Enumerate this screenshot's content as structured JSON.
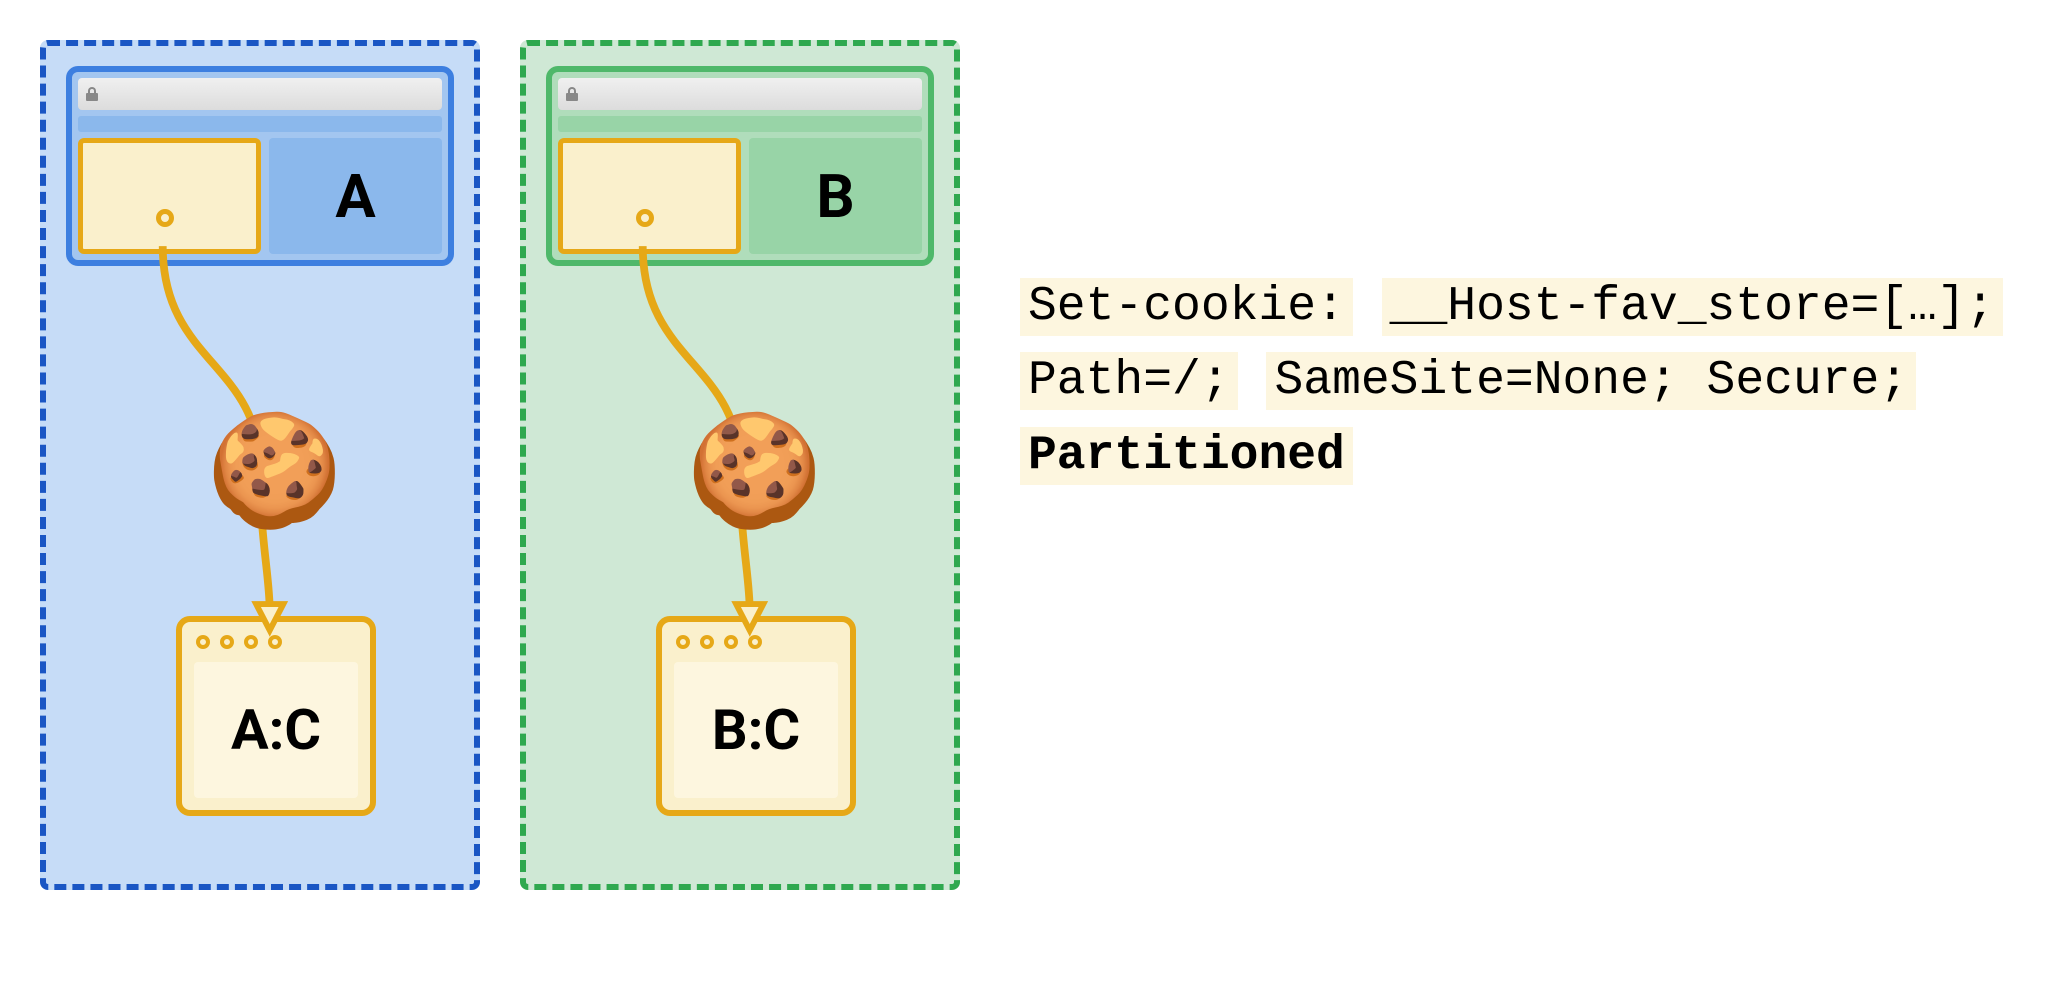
{
  "partitions": [
    {
      "theme": "blue",
      "site_label": "A",
      "jar_label": "A:C"
    },
    {
      "theme": "green",
      "site_label": "B",
      "jar_label": "B:C"
    }
  ],
  "code": {
    "line1": "Set-cookie:",
    "line2": "__Host-fav_store=[…];",
    "line3": "Path=/;",
    "line4": "SameSite=None; Secure;",
    "line5": "Partitioned"
  },
  "colors": {
    "blue_border": "#1a56c4",
    "blue_fill": "#c6dcf7",
    "green_border": "#2fa84f",
    "green_fill": "#cfe8d5",
    "orange": "#e6a817",
    "cream": "#faf0cc"
  }
}
